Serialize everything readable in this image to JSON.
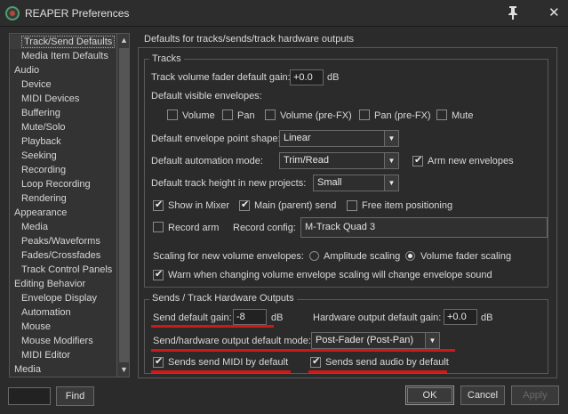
{
  "window": {
    "title": "REAPER Preferences"
  },
  "tree": {
    "items": [
      {
        "label": "Track/Send Defaults",
        "indent": true,
        "selected": true
      },
      {
        "label": "Media Item Defaults",
        "indent": true
      },
      {
        "label": "Audio",
        "indent": false
      },
      {
        "label": "Device",
        "indent": true
      },
      {
        "label": "MIDI Devices",
        "indent": true
      },
      {
        "label": "Buffering",
        "indent": true
      },
      {
        "label": "Mute/Solo",
        "indent": true
      },
      {
        "label": "Playback",
        "indent": true
      },
      {
        "label": "Seeking",
        "indent": true
      },
      {
        "label": "Recording",
        "indent": true
      },
      {
        "label": "Loop Recording",
        "indent": true
      },
      {
        "label": "Rendering",
        "indent": true
      },
      {
        "label": "Appearance",
        "indent": false
      },
      {
        "label": "Media",
        "indent": true
      },
      {
        "label": "Peaks/Waveforms",
        "indent": true
      },
      {
        "label": "Fades/Crossfades",
        "indent": true
      },
      {
        "label": "Track Control Panels",
        "indent": true
      },
      {
        "label": "Editing Behavior",
        "indent": false
      },
      {
        "label": "Envelope Display",
        "indent": true
      },
      {
        "label": "Automation",
        "indent": true
      },
      {
        "label": "Mouse",
        "indent": true
      },
      {
        "label": "Mouse Modifiers",
        "indent": true
      },
      {
        "label": "MIDI Editor",
        "indent": true
      },
      {
        "label": "Media",
        "indent": false
      }
    ]
  },
  "find": {
    "value": "",
    "button": "Find"
  },
  "page": {
    "heading": "Defaults for tracks/sends/track hardware outputs"
  },
  "tracks": {
    "group": "Tracks",
    "fader_label": "Track volume fader default gain:",
    "fader_value": "+0.0",
    "fader_unit": "dB",
    "envelopes_label": "Default visible envelopes:",
    "env_volume": "Volume",
    "env_pan": "Pan",
    "env_volume_prefx": "Volume (pre-FX)",
    "env_pan_prefx": "Pan (pre-FX)",
    "env_mute": "Mute",
    "shape_label": "Default envelope point shape:",
    "shape_value": "Linear",
    "automation_label": "Default automation mode:",
    "automation_value": "Trim/Read",
    "arm_label": "Arm new envelopes",
    "height_label": "Default track height in new projects:",
    "height_value": "Small",
    "show_mixer": "Show in Mixer",
    "main_send": "Main (parent) send",
    "free_pos": "Free item positioning",
    "record_arm": "Record arm",
    "record_config_label": "Record config:",
    "record_config_value": "M-Track Quad 3",
    "scaling_label": "Scaling for new volume envelopes:",
    "amp_scaling": "Amplitude scaling",
    "fader_scaling": "Volume fader scaling",
    "warn_label": "Warn when changing volume envelope scaling will change envelope sound"
  },
  "sends": {
    "group": "Sends / Track Hardware Outputs",
    "gain_label": "Send default gain:",
    "gain_value": "-8",
    "gain_unit": "dB",
    "hw_gain_label": "Hardware output default gain:",
    "hw_gain_value": "+0.0",
    "hw_gain_unit": "dB",
    "mode_label": "Send/hardware output default mode:",
    "mode_value": "Post-Fader (Post-Pan)",
    "midi_label": "Sends send MIDI by default",
    "audio_label": "Sends send audio by default"
  },
  "buttons": {
    "ok": "OK",
    "cancel": "Cancel",
    "apply": "Apply"
  },
  "colors": {
    "annotation_red": "#d01818"
  }
}
